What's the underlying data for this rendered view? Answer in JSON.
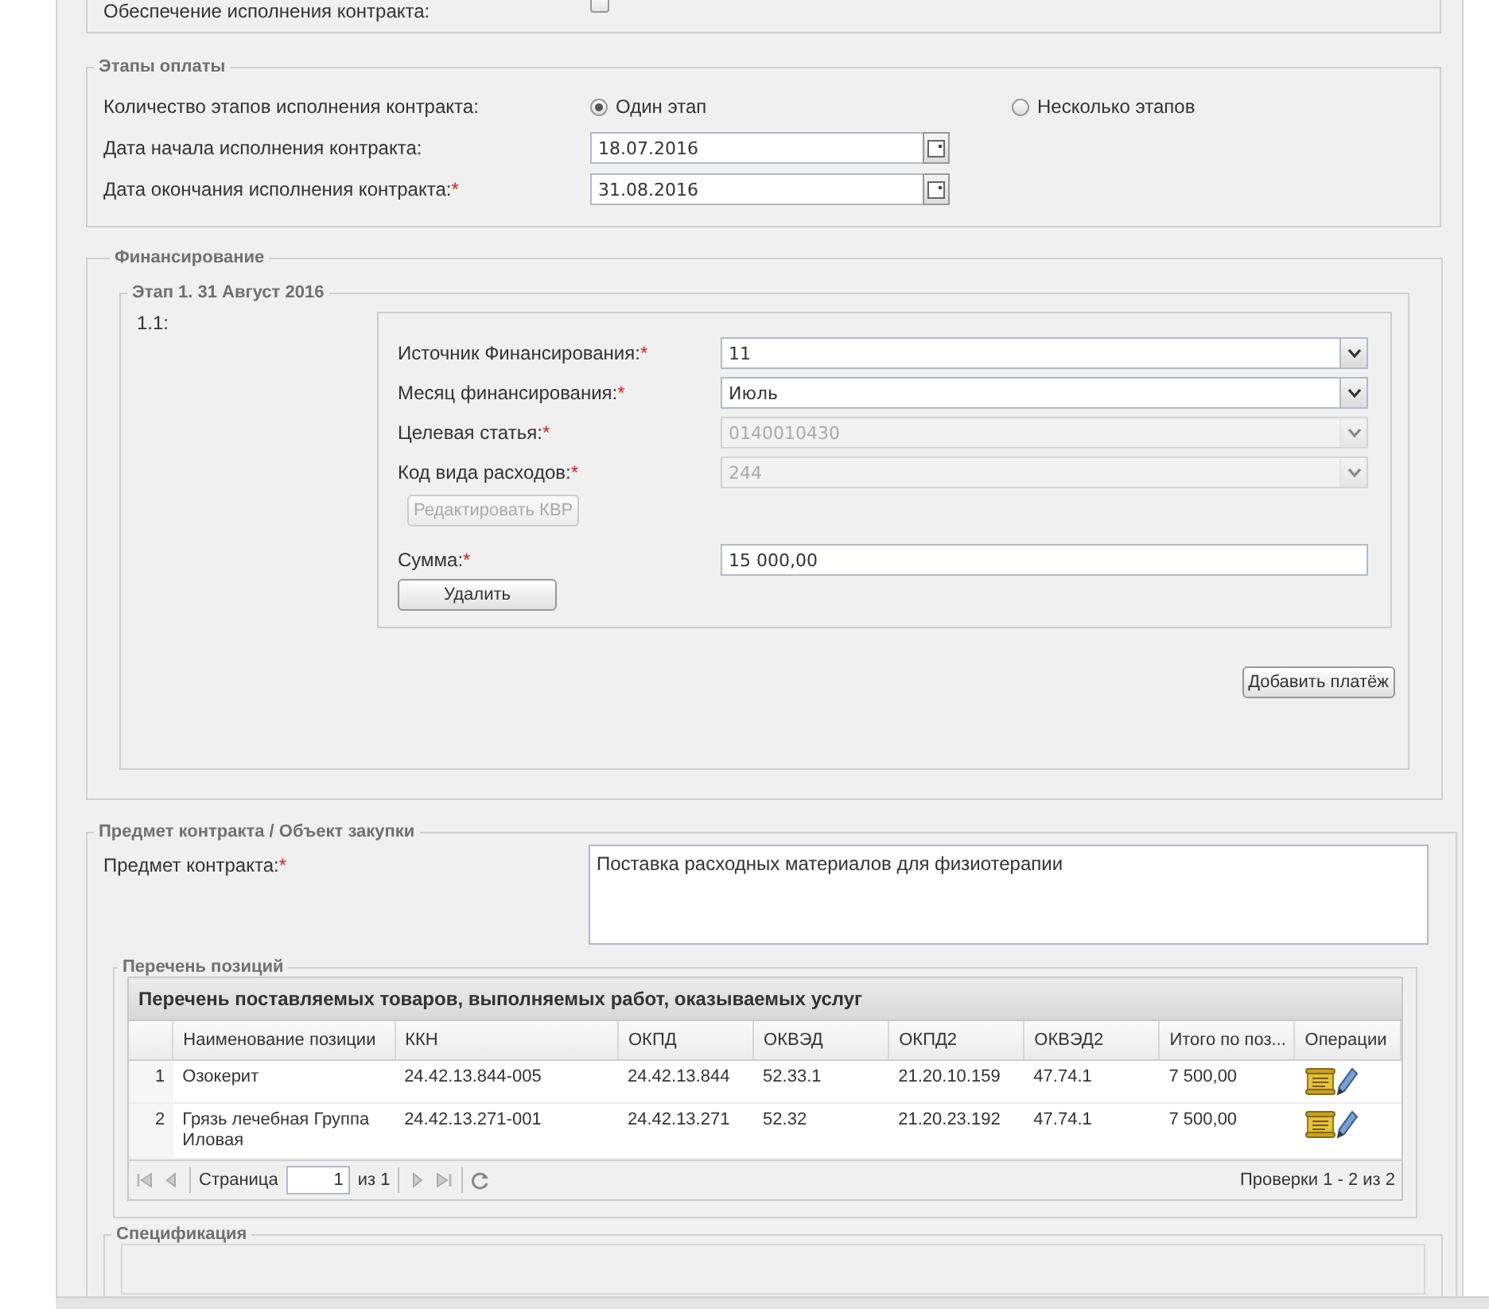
{
  "guarantee": {
    "label": "Обеспечение исполнения контракта:",
    "checked": false
  },
  "payment_stages": {
    "legend": "Этапы оплаты",
    "count_label": "Количество этапов исполнения контракта:",
    "options": [
      {
        "label": "Один этап",
        "selected": true
      },
      {
        "label": "Несколько этапов",
        "selected": false
      }
    ],
    "dates": [
      {
        "label": "Дата начала исполнения контракта:",
        "value": "18.07.2016"
      },
      {
        "label": "Дата окончания исполнения контракта:",
        "required_mark": "*",
        "value": "31.08.2016"
      }
    ]
  },
  "financing": {
    "legend": "Финансирование",
    "stage": {
      "legend": "Этап 1. 31 Август 2016",
      "number": "1.1:",
      "fields": [
        {
          "label": "Источник Финансирования:",
          "required_mark": "*",
          "value": "11",
          "disabled": false
        },
        {
          "label": "Месяц финансирования:",
          "required_mark": "*",
          "value": "Июль",
          "disabled": false
        },
        {
          "label": "Целевая статья:",
          "required_mark": "*",
          "value": "0140010430",
          "disabled": true
        },
        {
          "label": "Код вида расходов:",
          "required_mark": "*",
          "value": "244",
          "disabled": true
        }
      ],
      "edit_button": {
        "label": "Редактировать КВР",
        "disabled": true
      },
      "sum": {
        "label": "Сумма:",
        "required_mark": "*",
        "value": "15 000,00"
      },
      "delete_button": "Удалить"
    },
    "add_button": "Добавить платёж"
  },
  "subject": {
    "legend": "Предмет контракта / Объект закупки",
    "label": "Предмет контракта:",
    "required_mark": "*",
    "value": "Поставка расходных материалов для физиотерапии"
  },
  "positions": {
    "legend": "Перечень позиций",
    "grid_title": "Перечень поставляемых товаров, выполняемых работ, оказываемых услуг",
    "columns": [
      "Наименование позиции",
      "ККН",
      "ОКПД",
      "ОКВЭД",
      "ОКПД2",
      "ОКВЭД2",
      "Итого по поз...",
      "Операции"
    ],
    "rows": [
      {
        "number": "1",
        "cells": [
          "Озокерит",
          "24.42.13.844-005",
          "24.42.13.844",
          "52.33.1",
          "21.20.10.159",
          "47.74.1",
          "7 500,00"
        ]
      },
      {
        "number": "2",
        "cells": [
          "Грязь лечебная Группа Иловая",
          "24.42.13.271-001",
          "24.42.13.271",
          "52.32",
          "21.20.23.192",
          "47.74.1",
          "7 500,00"
        ]
      }
    ],
    "pager": {
      "page_label": "Страница",
      "page": "1",
      "of": "из 1",
      "summary": "Проверки 1 - 2 из 2"
    }
  },
  "specification": {
    "legend": "Спецификация"
  }
}
